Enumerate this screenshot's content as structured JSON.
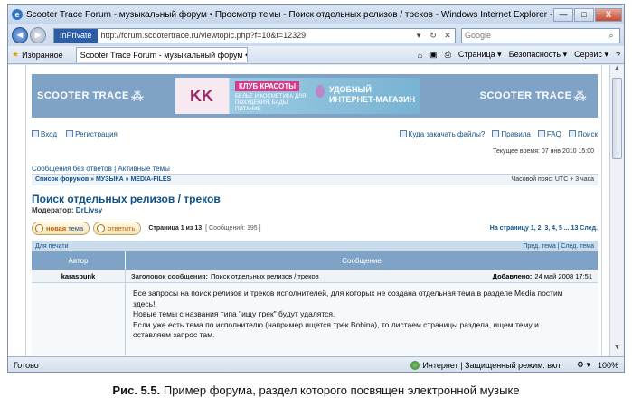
{
  "window": {
    "title": "Scooter Trace Forum - музыкальный форум • Просмотр темы - Поиск отдельных релизов / треков - Windows Internet Explorer - [InPri",
    "min": "—",
    "max": "□",
    "close": "X"
  },
  "nav": {
    "back": "◄",
    "forward": "►",
    "inprivate": "InPrivate",
    "url": "http://forum.scootertrace.ru/viewtopic.php?f=10&t=12329",
    "search_placeholder": "Google",
    "search_go": "⌕"
  },
  "favbar": {
    "favorites_label": "Избранное",
    "tab_title": "Scooter Trace Forum - музыкальный форум • П...",
    "page_label": "Страница ▾",
    "security_label": "Безопасность ▾",
    "service_label": "Сервис ▾",
    "help_label": "?"
  },
  "banner": {
    "logo_text": "SCOOTER TRACE",
    "ad_logo": "KK",
    "ad_club": "КЛУБ КРАСОТЫ",
    "ad_small": "БЕЛЬЕ И КОСМЕТИКА ДЛЯ ПОХУДЕНИЯ, БАДЫ, ПИТАНИЕ",
    "ad_shop": "УДОБНЫЙ ИНТЕРНЕТ-МАГАЗИН"
  },
  "forum": {
    "login": "Вход",
    "register": "Регистрация",
    "upload": "Куда закачать файлы?",
    "rules": "Правила",
    "faq": "FAQ",
    "search": "Поиск",
    "current_time": "Текущее время: 07 янв 2010 15:00",
    "unanswered": "Сообщения без ответов",
    "sep": "|",
    "active": "Активные темы",
    "breadcrumb": "Список форумов » МУЗЫКА » MEDIA-FILES",
    "timezone": "Часовой пояс: UTC + 3 часа",
    "topic_title": "Поиск отдельных релизов / треков",
    "moderator_label": "Модератор:",
    "moderator_name": "DrLivsy",
    "new_topic_a": "новая",
    "new_topic_b": "тема",
    "reply": "ответить",
    "page_info": "Страница 1 из 13",
    "msg_count": "[ Сообщений: 195 ]",
    "page_nav": "На страницу 1, 2, 3, 4, 5 ... 13  След.",
    "print": "Для печати",
    "prev_next": "Пред. тема | След. тема",
    "col_author": "Автор",
    "col_message": "Сообщение",
    "post_author": "karaspunk",
    "post_subject_label": "Заголовок сообщения:",
    "post_subject": "Поиск отдельных релизов / треков",
    "post_added_label": "Добавлено:",
    "post_added": "24 май 2008 17:51",
    "post_text": [
      "Все запросы на поиск релизов и треков исполнителей, для которых не создана отдельная тема в разделе Media постим",
      "здесь!",
      "Новые темы с названия типа \"ищу трек\" будут удалятся.",
      "Если уже есть тема по исполнителю (например ищется трек Bobina), то листаем страницы раздела, ищем тему и",
      "оставляем запрос там."
    ]
  },
  "status": {
    "left": "Готово",
    "zone": "Интернет | Защищенный режим: вкл.",
    "zoom": "100%"
  },
  "caption": {
    "bold": "Рис. 5.5.",
    "text": " Пример форума, раздел которого посвящен электронной музыке"
  }
}
